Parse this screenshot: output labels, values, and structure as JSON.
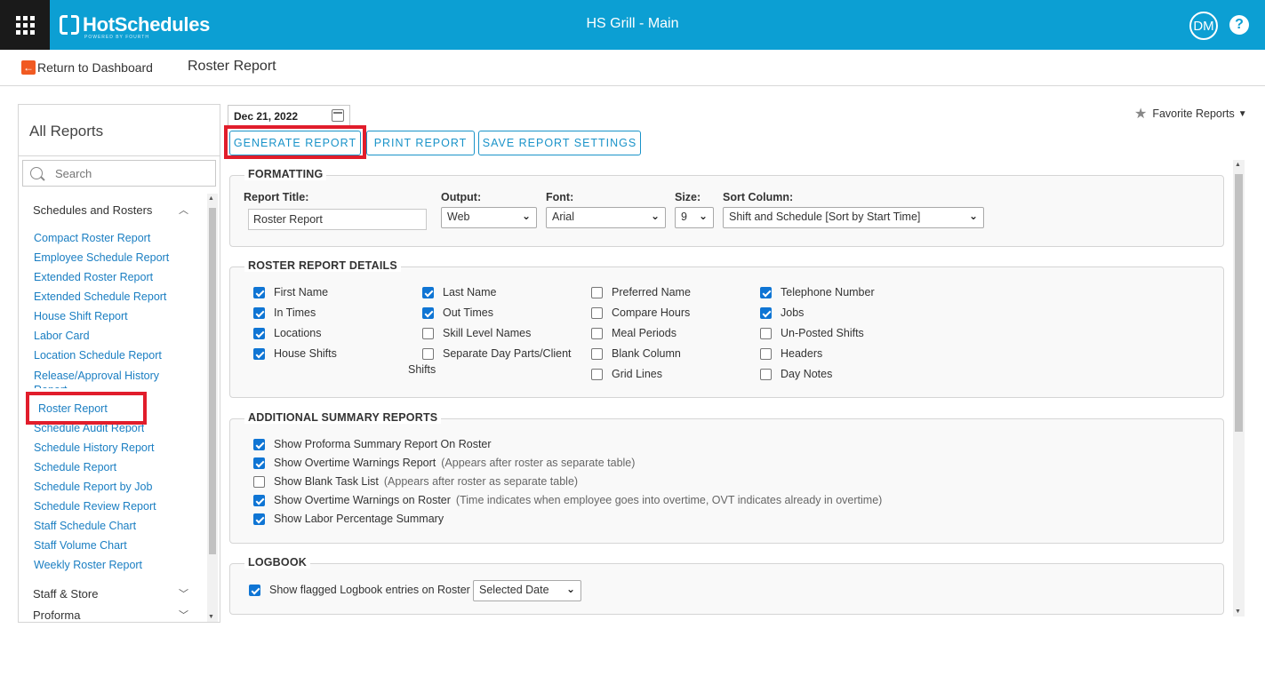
{
  "app": {
    "brand": "HotSchedules",
    "brand_sub": "POWERED BY FOURTH",
    "store_title": "HS Grill - Main",
    "user_initials": "DM",
    "help": "?"
  },
  "subheader": {
    "back_label": "Return to Dashboard",
    "page_title": "Roster Report"
  },
  "sidebar": {
    "title": "All Reports",
    "search_placeholder": "Search",
    "categories": [
      "Schedules and Rosters",
      "Staff & Store",
      "Proforma"
    ],
    "reports": [
      "Compact Roster Report",
      "Employee Schedule Report",
      "Extended Roster Report",
      "Extended Schedule Report",
      "House Shift Report",
      "Labor Card",
      "Location Schedule Report",
      "Release/Approval History Report",
      "Roster Report",
      "Schedule Audit Report",
      "Schedule History Report",
      "Schedule Report",
      "Schedule Report by Job",
      "Schedule Review Report",
      "Staff Schedule Chart",
      "Staff Volume Chart",
      "Weekly Roster Report"
    ]
  },
  "toolbar": {
    "date": "Dec 21, 2022",
    "favorite_label": "Favorite Reports",
    "generate": "GENERATE REPORT",
    "print": "PRINT REPORT",
    "save_settings": "SAVE REPORT SETTINGS"
  },
  "formatting": {
    "title": "FORMATTING",
    "report_title_label": "Report Title:",
    "report_title_value": "Roster Report",
    "output_label": "Output:",
    "output_value": "Web",
    "font_label": "Font:",
    "font_value": "Arial",
    "size_label": "Size:",
    "size_value": "9",
    "sort_label": "Sort Column:",
    "sort_value": "Shift and Schedule [Sort by Start Time]"
  },
  "roster_details": {
    "title": "ROSTER REPORT DETAILS",
    "options": [
      {
        "label": "First Name",
        "checked": true
      },
      {
        "label": "In Times",
        "checked": true
      },
      {
        "label": "Locations",
        "checked": true
      },
      {
        "label": "House Shifts",
        "checked": true
      },
      {
        "label": "Last Name",
        "checked": true
      },
      {
        "label": "Out Times",
        "checked": true
      },
      {
        "label": "Skill Level Names",
        "checked": false
      },
      {
        "label": "Separate Day Parts/Client",
        "label2": "Shifts",
        "checked": false
      },
      {
        "label": "Preferred Name",
        "checked": false
      },
      {
        "label": "Compare Hours",
        "checked": false
      },
      {
        "label": "Meal Periods",
        "checked": false
      },
      {
        "label": "Blank Column",
        "checked": false
      },
      {
        "label": "Grid Lines",
        "checked": false
      },
      {
        "label": "Telephone Number",
        "checked": true
      },
      {
        "label": "Jobs",
        "checked": true
      },
      {
        "label": "Un-Posted Shifts",
        "checked": false
      },
      {
        "label": "Headers",
        "checked": false
      },
      {
        "label": "Day Notes",
        "checked": false
      }
    ]
  },
  "summary": {
    "title": "ADDITIONAL SUMMARY REPORTS",
    "options": [
      {
        "label": "Show Proforma Summary Report On Roster",
        "note": "",
        "checked": true
      },
      {
        "label": "Show Overtime Warnings Report",
        "note": "(Appears after roster as separate table)",
        "checked": true
      },
      {
        "label": "Show Blank Task List",
        "note": "(Appears after roster as separate table)",
        "checked": false
      },
      {
        "label": "Show Overtime Warnings on Roster",
        "note": "(Time indicates when employee goes into overtime, OVT indicates already in overtime)",
        "checked": true
      },
      {
        "label": "Show Labor Percentage Summary",
        "note": "",
        "checked": true
      }
    ]
  },
  "logbook": {
    "title": "LOGBOOK",
    "option": {
      "label": "Show flagged Logbook entries on Roster",
      "checked": true
    },
    "select_value": "Selected Date"
  },
  "colors": {
    "brand": "#0c9fd3",
    "link": "#1a7ec2",
    "button": "#1a93c9",
    "highlight": "#e11d2b",
    "checkbox": "#0f75d4"
  },
  "icons": [
    "apps-grid-icon",
    "hotschedules-logo",
    "help-icon",
    "back-arrow-icon",
    "search-icon",
    "calendar-icon",
    "star-icon",
    "chevron-up-icon",
    "chevron-down-icon"
  ]
}
